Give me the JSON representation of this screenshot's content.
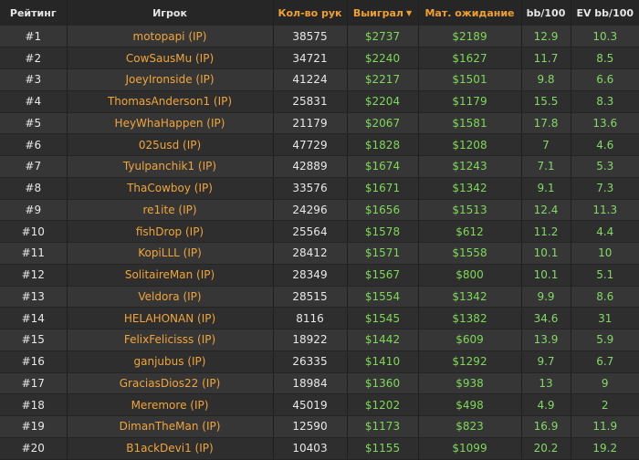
{
  "headers": {
    "rank": "Рейтинг",
    "player": "Игрок",
    "hands": "Кол-во рук",
    "won": "Выиграл",
    "won_sort_icon": "▼",
    "ev": "Мат. ожидание",
    "bb100": "bb/100",
    "evbb100": "EV bb/100"
  },
  "rows": [
    {
      "rank": "#1",
      "player": "motopapi (IP)",
      "hands": "38575",
      "won": "$2737",
      "ev": "$2189",
      "bb100": "12.9",
      "evbb100": "10.3"
    },
    {
      "rank": "#2",
      "player": "CowSausMu (IP)",
      "hands": "34721",
      "won": "$2240",
      "ev": "$1627",
      "bb100": "11.7",
      "evbb100": "8.5"
    },
    {
      "rank": "#3",
      "player": "JoeyIronside (IP)",
      "hands": "41224",
      "won": "$2217",
      "ev": "$1501",
      "bb100": "9.8",
      "evbb100": "6.6"
    },
    {
      "rank": "#4",
      "player": "ThomasAnderson1 (IP)",
      "hands": "25831",
      "won": "$2204",
      "ev": "$1179",
      "bb100": "15.5",
      "evbb100": "8.3"
    },
    {
      "rank": "#5",
      "player": "HeyWhaHappen (IP)",
      "hands": "21179",
      "won": "$2067",
      "ev": "$1581",
      "bb100": "17.8",
      "evbb100": "13.6"
    },
    {
      "rank": "#6",
      "player": "025usd (IP)",
      "hands": "47729",
      "won": "$1828",
      "ev": "$1208",
      "bb100": "7",
      "evbb100": "4.6"
    },
    {
      "rank": "#7",
      "player": "Tyulpanchik1 (IP)",
      "hands": "42889",
      "won": "$1674",
      "ev": "$1243",
      "bb100": "7.1",
      "evbb100": "5.3"
    },
    {
      "rank": "#8",
      "player": "ThaCowboy (IP)",
      "hands": "33576",
      "won": "$1671",
      "ev": "$1342",
      "bb100": "9.1",
      "evbb100": "7.3"
    },
    {
      "rank": "#9",
      "player": "re1ite (IP)",
      "hands": "24296",
      "won": "$1656",
      "ev": "$1513",
      "bb100": "12.4",
      "evbb100": "11.3"
    },
    {
      "rank": "#10",
      "player": "fishDrop (IP)",
      "hands": "25564",
      "won": "$1578",
      "ev": "$612",
      "bb100": "11.2",
      "evbb100": "4.4"
    },
    {
      "rank": "#11",
      "player": "KopiLLL (IP)",
      "hands": "28412",
      "won": "$1571",
      "ev": "$1558",
      "bb100": "10.1",
      "evbb100": "10"
    },
    {
      "rank": "#12",
      "player": "SolitaireMan (IP)",
      "hands": "28349",
      "won": "$1567",
      "ev": "$800",
      "bb100": "10.1",
      "evbb100": "5.1"
    },
    {
      "rank": "#13",
      "player": "Veldora (IP)",
      "hands": "28515",
      "won": "$1554",
      "ev": "$1342",
      "bb100": "9.9",
      "evbb100": "8.6"
    },
    {
      "rank": "#14",
      "player": "HELAHONAN (IP)",
      "hands": "8116",
      "won": "$1545",
      "ev": "$1382",
      "bb100": "34.6",
      "evbb100": "31"
    },
    {
      "rank": "#15",
      "player": "FelixFelicisss (IP)",
      "hands": "18922",
      "won": "$1442",
      "ev": "$609",
      "bb100": "13.9",
      "evbb100": "5.9"
    },
    {
      "rank": "#16",
      "player": "ganjubus (IP)",
      "hands": "26335",
      "won": "$1410",
      "ev": "$1292",
      "bb100": "9.7",
      "evbb100": "6.7"
    },
    {
      "rank": "#17",
      "player": "GraciasDios22 (IP)",
      "hands": "18984",
      "won": "$1360",
      "ev": "$938",
      "bb100": "13",
      "evbb100": "9"
    },
    {
      "rank": "#18",
      "player": "Meremore (IP)",
      "hands": "45019",
      "won": "$1202",
      "ev": "$498",
      "bb100": "4.9",
      "evbb100": "2"
    },
    {
      "rank": "#19",
      "player": "DimanTheMan (IP)",
      "hands": "12590",
      "won": "$1173",
      "ev": "$823",
      "bb100": "16.9",
      "evbb100": "11.9"
    },
    {
      "rank": "#20",
      "player": "B1ackDevi1 (IP)",
      "hands": "10403",
      "won": "$1155",
      "ev": "$1099",
      "bb100": "20.2",
      "evbb100": "19.2"
    }
  ]
}
